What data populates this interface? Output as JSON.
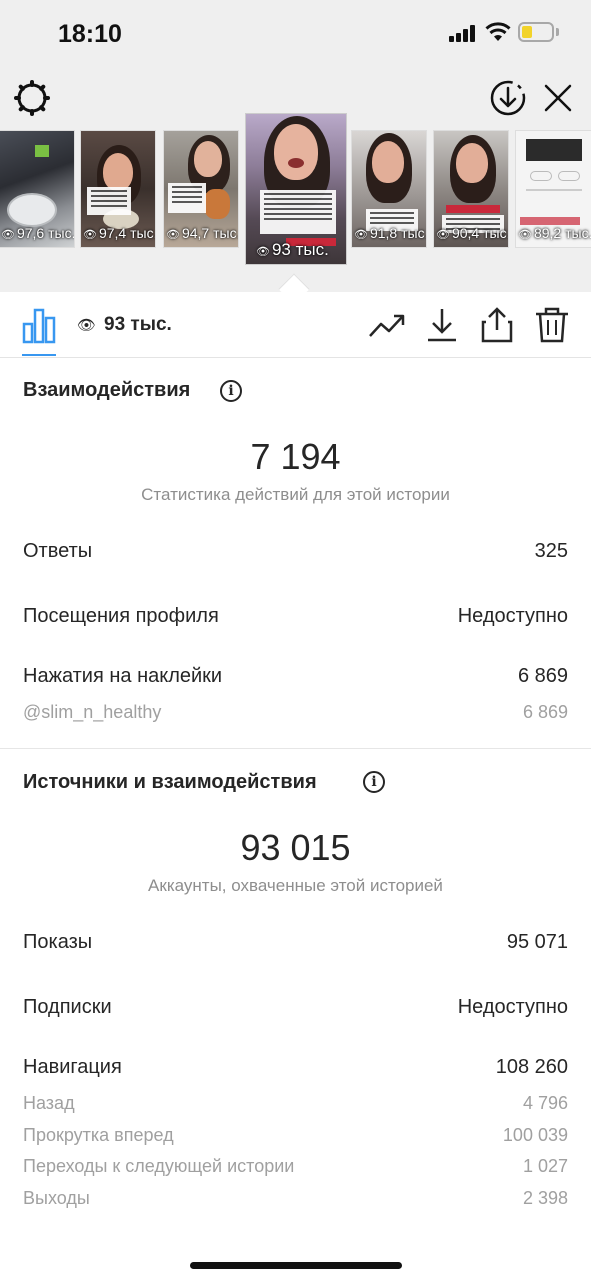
{
  "status_bar": {
    "time": "18:10"
  },
  "thumbnails": [
    {
      "views": "97,6 тыс."
    },
    {
      "views": "97,4 тыс."
    },
    {
      "views": "94,7 тыс."
    },
    {
      "views": "93 тыс.",
      "selected": true
    },
    {
      "views": "91,8 тыс."
    },
    {
      "views": "90,4 тыс."
    },
    {
      "views": "89,2 тыс."
    }
  ],
  "toolbar": {
    "views": "93 тыс."
  },
  "interactions": {
    "title": "Взаимодействия",
    "info": "i",
    "total": "7 194",
    "caption": "Статистика действий для этой истории",
    "rows": [
      {
        "label": "Ответы",
        "value": "325"
      },
      {
        "label": "Посещения профиля",
        "value": "Недоступно"
      },
      {
        "label": "Нажатия на наклейки",
        "value": "6 869"
      }
    ],
    "sub_rows": [
      {
        "label": "@slim_n_healthy",
        "value": "6 869"
      }
    ]
  },
  "discovery": {
    "title": "Источники и взаимодействия",
    "info": "i",
    "total": "93 015",
    "caption": "Аккаунты, охваченные этой историей",
    "rows": [
      {
        "label": "Показы",
        "value": "95 071"
      },
      {
        "label": "Подписки",
        "value": "Недоступно"
      },
      {
        "label": "Навигация",
        "value": "108 260"
      }
    ],
    "sub_rows": [
      {
        "label": "Назад",
        "value": "4 796"
      },
      {
        "label": "Прокрутка вперед",
        "value": "100 039"
      },
      {
        "label": "Переходы к следующей истории",
        "value": "1 027"
      },
      {
        "label": "Выходы",
        "value": "2 398"
      }
    ]
  },
  "colors": {
    "accent": "#3897f0",
    "muted": "#8e8e8e",
    "top_bg": "#efefef"
  }
}
